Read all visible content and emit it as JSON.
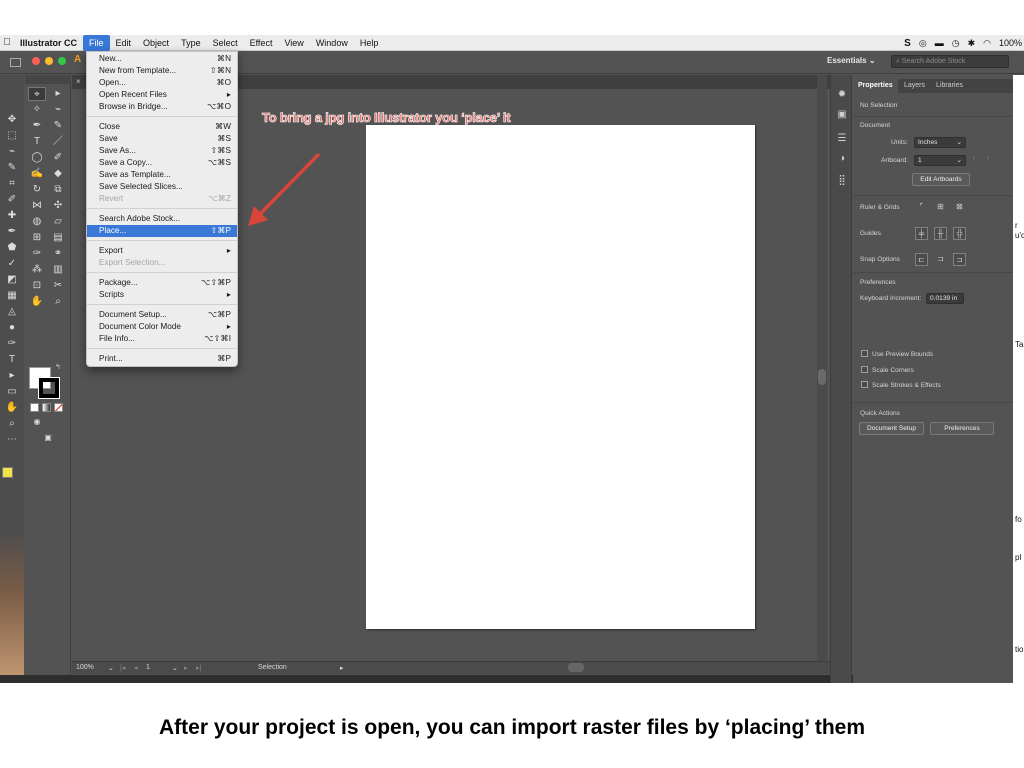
{
  "menubar": {
    "app_name": "Illustrator CC",
    "items": [
      "File",
      "Edit",
      "Object",
      "Type",
      "Select",
      "Effect",
      "View",
      "Window",
      "Help"
    ],
    "battery": "100%"
  },
  "appbar": {
    "tab_fragment": "A",
    "workspace": "Essentials",
    "stock_placeholder": "Search Adobe Stock"
  },
  "file_menu": {
    "items": [
      {
        "label": "New...",
        "shortcut": "⌘N"
      },
      {
        "label": "New from Template...",
        "shortcut": "⇧⌘N"
      },
      {
        "label": "Open...",
        "shortcut": "⌘O"
      },
      {
        "label": "Open Recent Files",
        "shortcut": "▸"
      },
      {
        "label": "Browse in Bridge...",
        "shortcut": "⌥⌘O"
      },
      {
        "label": "Close",
        "shortcut": "⌘W"
      },
      {
        "label": "Save",
        "shortcut": "⌘S"
      },
      {
        "label": "Save As...",
        "shortcut": "⇧⌘S"
      },
      {
        "label": "Save a Copy...",
        "shortcut": "⌥⌘S"
      },
      {
        "label": "Save as Template...",
        "shortcut": ""
      },
      {
        "label": "Save Selected Slices...",
        "shortcut": ""
      },
      {
        "label": "Revert",
        "shortcut": "⌥⌘Z"
      },
      {
        "label": "Search Adobe Stock...",
        "shortcut": ""
      },
      {
        "label": "Place...",
        "shortcut": "⇧⌘P"
      },
      {
        "label": "Export",
        "shortcut": "▸"
      },
      {
        "label": "Export Selection...",
        "shortcut": ""
      },
      {
        "label": "Package...",
        "shortcut": "⌥⇧⌘P"
      },
      {
        "label": "Scripts",
        "shortcut": "▸"
      },
      {
        "label": "Document Setup...",
        "shortcut": "⌥⌘P"
      },
      {
        "label": "Document Color Mode",
        "shortcut": "▸"
      },
      {
        "label": "File Info...",
        "shortcut": "⌥⇧⌘I"
      },
      {
        "label": "Print...",
        "shortcut": "⌘P"
      }
    ]
  },
  "annotation": "To bring a jpg into Illustrator you ‘place’ it",
  "status": {
    "zoom": "100%",
    "artboard_num": "1",
    "tool": "Selection"
  },
  "properties": {
    "tabs": [
      "Properties",
      "Layers",
      "Libraries"
    ],
    "no_selection": "No Selection",
    "document_heading": "Document",
    "units_label": "Units:",
    "units_value": "Inches",
    "artboard_label": "Artboard:",
    "artboard_value": "1",
    "edit_artboards": "Edit Artboards",
    "ruler_grids": "Ruler & Grids",
    "guides": "Guides",
    "snap_options": "Snap Options",
    "preferences_heading": "Preferences",
    "keyboard_increment_label": "Keyboard Increment:",
    "keyboard_increment_value": "0.0139 in",
    "checkboxes": [
      "Use Preview Bounds",
      "Scale Corners",
      "Scale Strokes & Effects"
    ],
    "quick_actions": "Quick Actions",
    "document_setup_btn": "Document Setup",
    "preferences_btn": "Preferences"
  },
  "right_fragment": [
    "r",
    "u'c",
    "Ta",
    "fo",
    "pl",
    "tio"
  ],
  "caption": "After your project is open, you can import raster files by ‘placing’ them",
  "colors": {
    "menu_highlight": "#3a78d8",
    "annotation_red": "#e8625c",
    "arrow_red": "#d9453b"
  }
}
